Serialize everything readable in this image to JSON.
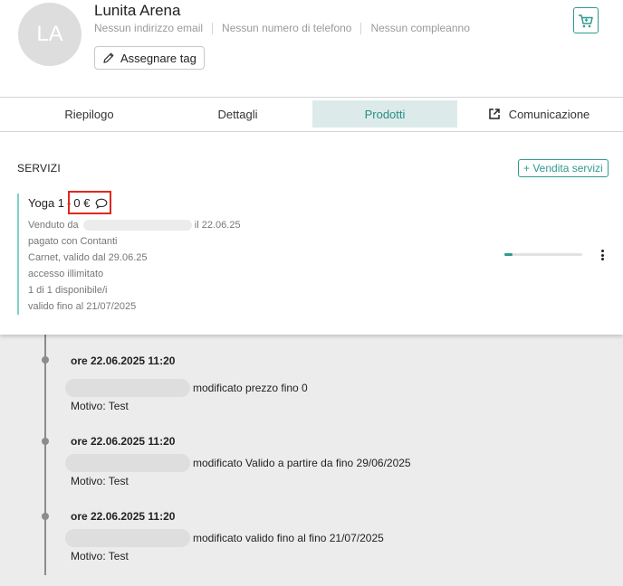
{
  "profile": {
    "initials": "LA",
    "name": "Lunita Arena",
    "email": "Nessun indirizzo email",
    "phone": "Nessun numero di telefono",
    "birthday": "Nessun compleanno",
    "tag_button": "Assegnare tag"
  },
  "tabs": [
    {
      "label": "Riepilogo"
    },
    {
      "label": "Dettagli"
    },
    {
      "label": "Prodotti"
    },
    {
      "label": "Comunicazione"
    }
  ],
  "services": {
    "title": "SERVIZI",
    "sell_button": "+ Vendita servizi",
    "item": {
      "name": "Yoga 1",
      "separator": "-",
      "price": "0 €",
      "sold_by": "Venduto da",
      "sold_date": "il 22.06.25",
      "payment": "pagato con Contanti",
      "validity": "Carnet, valido dal 29.06.25",
      "access": "accesso illimitato",
      "availability": "1 di 1 disponibile/i",
      "valid_until": "valido fino al 21/07/2025",
      "progress_fraction": 0.1
    }
  },
  "history": [
    {
      "time": "ore 22.06.2025 11:20",
      "change": "modificato prezzo fino 0",
      "reason": "Motivo: Test"
    },
    {
      "time": "ore 22.06.2025 11:20",
      "change": "modificato Valido a partire da fino 29/06/2025",
      "reason": "Motivo: Test"
    },
    {
      "time": "ore 22.06.2025 11:20",
      "change": "modificato valido fino al fino 21/07/2025",
      "reason": "Motivo: Test"
    }
  ],
  "colors": {
    "accent": "#2e9a8e",
    "highlight": "#e0281c",
    "active_tab_bg": "#dcebea"
  }
}
